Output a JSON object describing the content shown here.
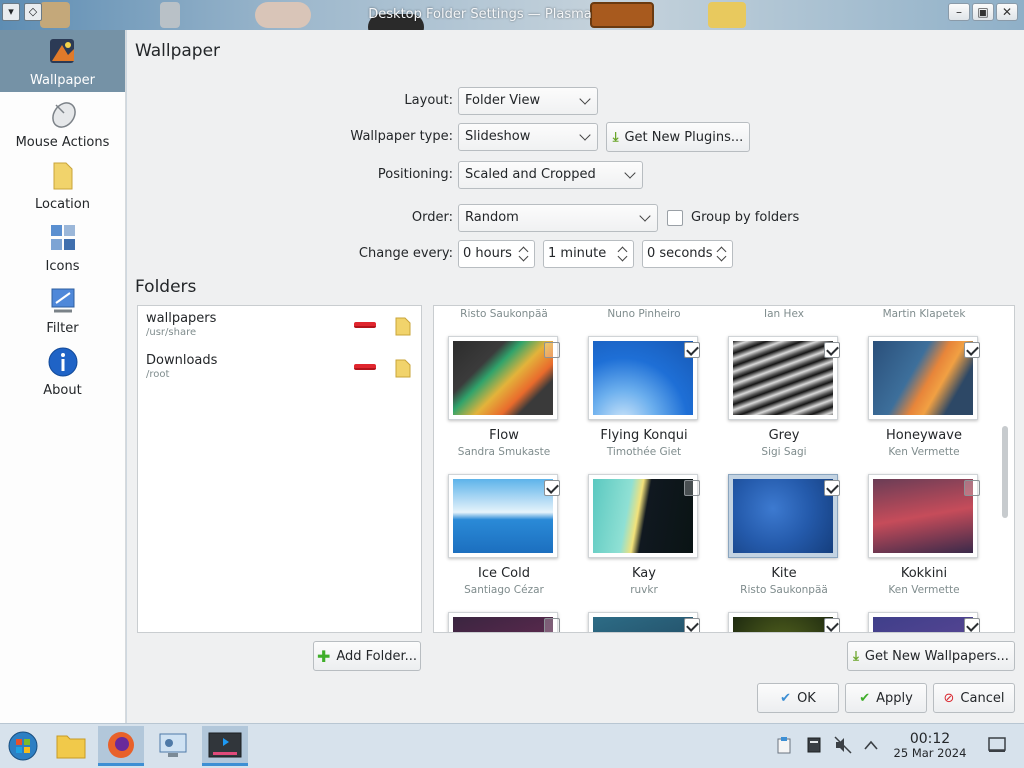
{
  "window": {
    "title": "Desktop Folder Settings — Plasma"
  },
  "sidebar": {
    "items": [
      {
        "label": "Wallpaper"
      },
      {
        "label": "Mouse Actions"
      },
      {
        "label": "Location"
      },
      {
        "label": "Icons"
      },
      {
        "label": "Filter"
      },
      {
        "label": "About"
      }
    ]
  },
  "wallpaper": {
    "heading": "Wallpaper",
    "layout_label": "Layout:",
    "layout_value": "Folder View",
    "type_label": "Wallpaper type:",
    "type_value": "Slideshow",
    "get_plugins": "Get New Plugins...",
    "positioning_label": "Positioning:",
    "positioning_value": "Scaled and Cropped",
    "order_label": "Order:",
    "order_value": "Random",
    "group_by_folders": "Group by folders",
    "change_every_label": "Change every:",
    "hours": "0 hours",
    "minutes": "1 minute",
    "seconds": "0 seconds"
  },
  "folders": {
    "heading": "Folders",
    "items": [
      {
        "name": "wallpapers",
        "path": "/usr/share"
      },
      {
        "name": "Downloads",
        "path": "/root"
      }
    ],
    "add_folder": "Add Folder..."
  },
  "grid": {
    "top_authors": [
      "Risto Saukonpää",
      "Nuno Pinheiro",
      "Ian Hex",
      "Martin Klapetek"
    ],
    "tiles": [
      {
        "name": "Flow",
        "author": "Sandra Smukaste",
        "checked": false
      },
      {
        "name": "Flying Konqui",
        "author": "Timothée Giet",
        "checked": true
      },
      {
        "name": "Grey",
        "author": "Sigi Sagi",
        "checked": true
      },
      {
        "name": "Honeywave",
        "author": "Ken Vermette",
        "checked": true
      },
      {
        "name": "Ice Cold",
        "author": "Santiago Cézar",
        "checked": true
      },
      {
        "name": "Kay",
        "author": "ruvkr",
        "checked": false
      },
      {
        "name": "Kite",
        "author": "Risto Saukonpää",
        "checked": true
      },
      {
        "name": "Kokkini",
        "author": "Ken Vermette",
        "checked": false
      }
    ],
    "get_wallpapers": "Get New Wallpapers..."
  },
  "dialog": {
    "ok": "OK",
    "apply": "Apply",
    "cancel": "Cancel"
  },
  "taskbar": {
    "time": "00:12",
    "date": "25 Mar 2024"
  },
  "colors": {
    "accent": "#3d8fd4",
    "sidebar_active": "#7592a6",
    "remove": "#e0262e"
  }
}
